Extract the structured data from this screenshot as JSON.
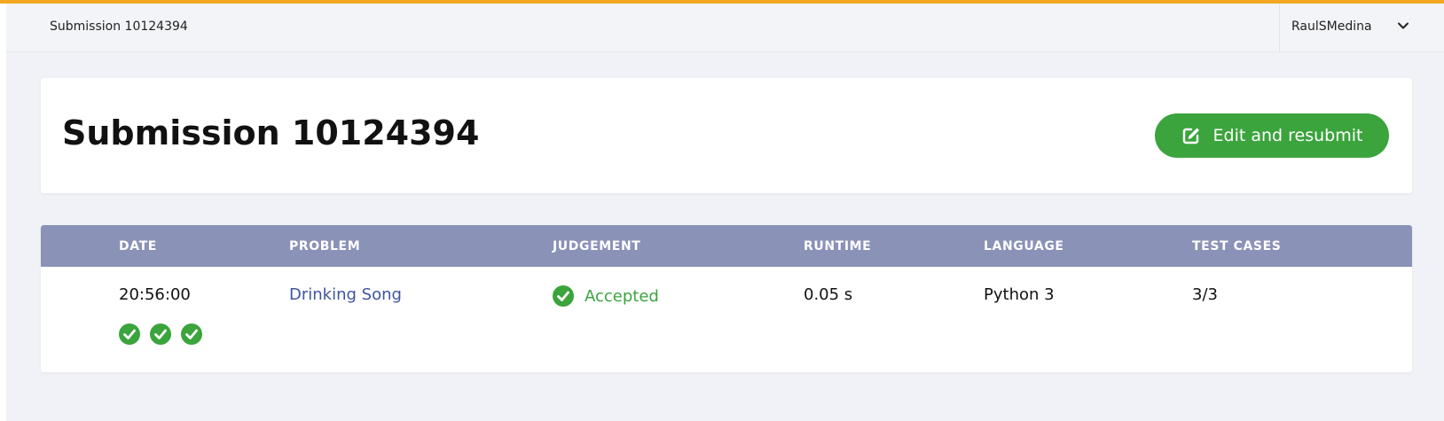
{
  "topbar": {
    "title": "Submission 10124394",
    "user": "RaulSMedina"
  },
  "header": {
    "title": "Submission 10124394",
    "resubmit_label": "Edit and resubmit"
  },
  "table": {
    "columns": [
      "DATE",
      "PROBLEM",
      "JUDGEMENT",
      "RUNTIME",
      "LANGUAGE",
      "TEST CASES"
    ],
    "row": {
      "date": "20:56:00",
      "problem": "Drinking Song",
      "judgement": "Accepted",
      "runtime": "0.05 s",
      "language": "Python 3",
      "test_cases": "3/3"
    },
    "test_case_results": [
      "accepted",
      "accepted",
      "accepted"
    ]
  },
  "colors": {
    "accent_bar": "#f5a623",
    "success": "#3ba43d",
    "table_header": "#8a92b8",
    "link": "#3e55a0"
  },
  "icons": {
    "resubmit": "edit-icon",
    "status": "check-circle-icon",
    "menu": "chevron-down-icon"
  }
}
